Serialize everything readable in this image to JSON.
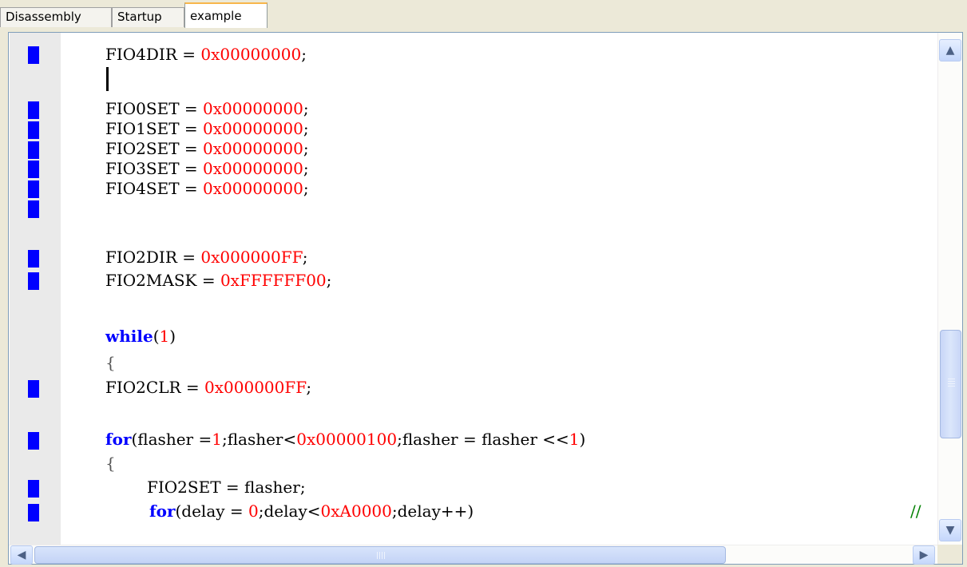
{
  "tabs": [
    {
      "label": "Disassembly",
      "active": false
    },
    {
      "label": "Startup",
      "active": false
    },
    {
      "label": "example",
      "active": true
    }
  ],
  "colors": {
    "keyword": "#0000ff",
    "number": "#ff0000",
    "comment": "#008000",
    "marker": "#0000ff",
    "active_tab_accent": "#f7b64b"
  },
  "code": {
    "l1_a": "FIO4DIR = ",
    "l1_n": "0x00000000",
    "l1_b": ";",
    "l3_a": "FIO0SET = ",
    "l3_n": "0x00000000",
    "l3_b": ";",
    "l4_a": "FIO1SET = ",
    "l4_n": "0x00000000",
    "l4_b": ";",
    "l5_a": "FIO2SET = ",
    "l5_n": "0x00000000",
    "l5_b": ";",
    "l6_a": "FIO3SET = ",
    "l6_n": "0x00000000",
    "l6_b": ";",
    "l7_a": "FIO4SET = ",
    "l7_n": "0x00000000",
    "l7_b": ";",
    "l9_a": "FIO2DIR = ",
    "l9_n": "0x000000FF",
    "l9_b": ";",
    "l10_a": "FIO2MASK = ",
    "l10_n": "0xFFFFFF00",
    "l10_b": ";",
    "l12_kw": "while",
    "l12_a": "(",
    "l12_n": "1",
    "l12_b": ")",
    "l13": "{",
    "l14_a": "FIO2CLR = ",
    "l14_n": "0x000000FF",
    "l14_b": ";",
    "l16_kw": "for",
    "l16_a": "(flasher =",
    "l16_n1": "1",
    "l16_b": ";flasher<",
    "l16_n2": "0x00000100",
    "l16_c": ";flasher = flasher <<",
    "l16_n3": "1",
    "l16_d": ")",
    "l17": "{",
    "l18": "FIO2SET = flasher;",
    "l19_kw": "for",
    "l19_a": "(delay = ",
    "l19_n1": "0",
    "l19_b": ";delay<",
    "l19_n2": "0xA0000",
    "l19_c": ";delay++)",
    "l19_cmt": "//"
  },
  "scrollbar": {
    "up_arrow": "▲",
    "down_arrow": "▼",
    "left_arrow": "◀",
    "right_arrow": "▶"
  }
}
